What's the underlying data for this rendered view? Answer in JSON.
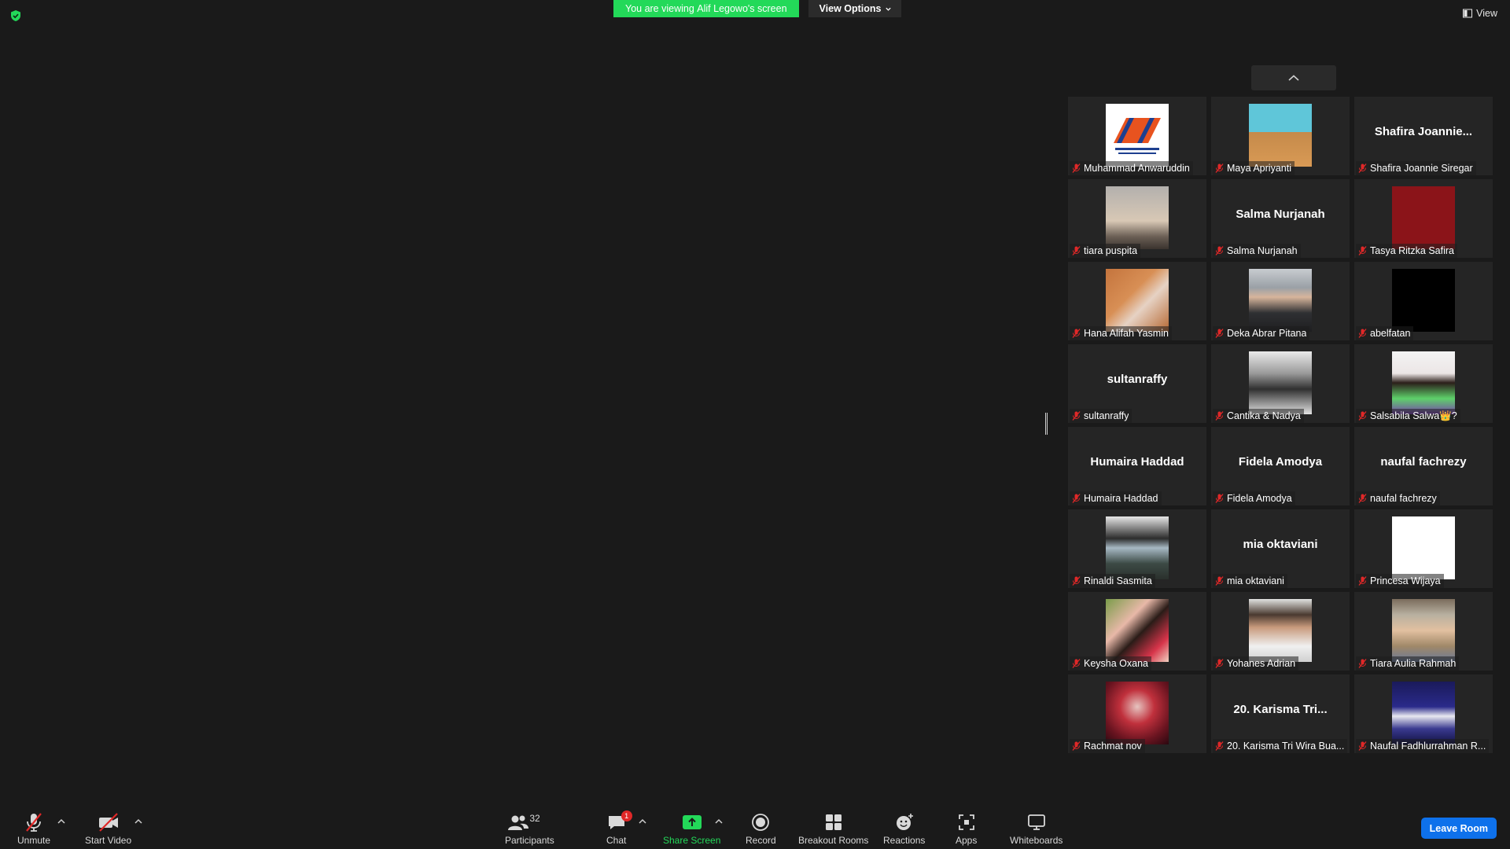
{
  "banner": {
    "viewing_prefix": "You are viewing ",
    "viewing_name": "Alif Legowo's screen",
    "options_label": "View Options"
  },
  "view_label": "View",
  "colors": {
    "accent_green": "#23d959",
    "leave_blue": "#0e71eb",
    "muted_red": "#e02828"
  },
  "participants": [
    {
      "name": "Muhammad Anwaruddin",
      "photo": "logo"
    },
    {
      "name": "Maya Apriyanti",
      "photo": "giraffe"
    },
    {
      "name": "Shafira Joannie Siregar",
      "display": "Shafira  Joannie..."
    },
    {
      "name": "tiara puspita",
      "photo": "sky"
    },
    {
      "name": "Salma Nurjanah",
      "display": "Salma Nurjanah"
    },
    {
      "name": "Tasya Ritzka Safira",
      "photo": "red"
    },
    {
      "name": "Hana Alifah Yasmin",
      "photo": "brick"
    },
    {
      "name": "Deka Abrar Pitana",
      "photo": "portrait-m"
    },
    {
      "name": "abelfatan",
      "photo": "black"
    },
    {
      "name": "sultanraffy",
      "display": "sultanraffy"
    },
    {
      "name": "Cantika & Nadya",
      "photo": "bw"
    },
    {
      "name": "Salsabila Salwa👑?",
      "photo": "green-dress"
    },
    {
      "name": "Humaira Haddad",
      "display": "Humaira Haddad"
    },
    {
      "name": "Fidela Amodya",
      "display": "Fidela Amodya"
    },
    {
      "name": "naufal fachrezy",
      "display": "naufal fachrezy"
    },
    {
      "name": "Rinaldi Sasmita",
      "photo": "masked"
    },
    {
      "name": "mia oktaviani",
      "display": "mia oktaviani"
    },
    {
      "name": "Princesa Wijaya",
      "photo": "white"
    },
    {
      "name": "Keysha Oxana",
      "photo": "selfie"
    },
    {
      "name": "Yohanes Adrian",
      "photo": "glasses"
    },
    {
      "name": "Tiara Aulia Rahmah",
      "photo": "baby"
    },
    {
      "name": "Rachmat nov",
      "photo": "red-lights"
    },
    {
      "name": "20. Karisma Tri Wira Bua...",
      "display": "20. Karisma Tri..."
    },
    {
      "name": "Naufal Fadhlurrahman R...",
      "photo": "night"
    }
  ],
  "toolbar": {
    "unmute": "Unmute",
    "start_video": "Start Video",
    "participants": "Participants",
    "participants_count": "32",
    "chat": "Chat",
    "chat_badge": "1",
    "share_screen": "Share Screen",
    "record": "Record",
    "breakout_rooms": "Breakout Rooms",
    "reactions": "Reactions",
    "apps": "Apps",
    "whiteboards": "Whiteboards",
    "leave_room": "Leave Room"
  }
}
